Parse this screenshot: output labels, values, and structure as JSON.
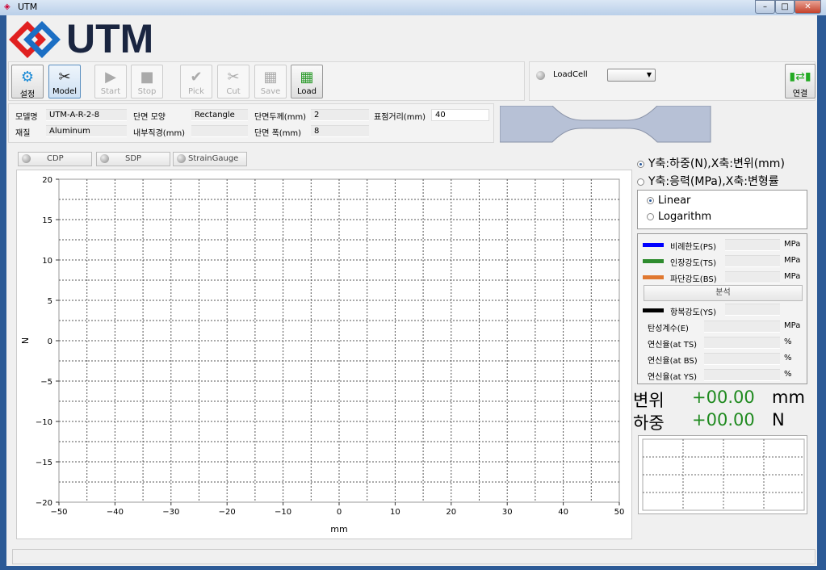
{
  "window": {
    "title": "UTM",
    "icon": "utm-logo-icon"
  },
  "logo": {
    "text": "UTM"
  },
  "toolbar": {
    "buttons": [
      {
        "label": "설정",
        "icon": "gear-icon",
        "enabled": true
      },
      {
        "label": "Model",
        "icon": "tools-icon",
        "enabled": true
      },
      {
        "label": "Start",
        "icon": "play-icon",
        "enabled": false
      },
      {
        "label": "Stop",
        "icon": "stop-icon",
        "enabled": false
      },
      {
        "label": "Pick",
        "icon": "check-icon",
        "enabled": false
      },
      {
        "label": "Cut",
        "icon": "scissors-icon",
        "enabled": false
      },
      {
        "label": "Save",
        "icon": "excel-icon",
        "enabled": false
      },
      {
        "label": "Load",
        "icon": "excel-icon",
        "enabled": true
      }
    ],
    "loadcell_label": "LoadCell",
    "loadcell_value": "",
    "connect_label": "연결"
  },
  "specimen": {
    "model_label": "모델명",
    "model_value": "UTM-A-R-2-8",
    "material_label": "재질",
    "material_value": "Aluminum",
    "shape_label": "단면 모양",
    "shape_value": "Rectangle",
    "inner_diameter_label": "내부직경(mm)",
    "inner_diameter_value": "",
    "thickness_label": "단면두께(mm)",
    "thickness_value": "2",
    "width_label": "단면 폭(mm)",
    "width_value": "8",
    "gauge_label": "표점거리(mm)",
    "gauge_value": "40"
  },
  "sensors": [
    "CDP",
    "SDP",
    "StrainGauge"
  ],
  "axis_mode": {
    "options": [
      "Y축:하중(N),X축:변위(mm)",
      "Y축:응력(MPa),X축:변형률"
    ],
    "selected": 0
  },
  "scale": {
    "options": [
      "Linear",
      "Logarithm"
    ],
    "selected": 0
  },
  "stats": {
    "rows": [
      {
        "label": "비례한도(PS)",
        "unit": "MPa",
        "color": "#0000ff"
      },
      {
        "label": "인장강도(TS)",
        "unit": "MPa",
        "color": "#2e8b2e"
      },
      {
        "label": "파단강도(BS)",
        "unit": "MPa",
        "color": "#e07830"
      }
    ],
    "analyze_label": "분석",
    "yield": {
      "label": "항복강도(YS)",
      "color": "#000000"
    },
    "rows2": [
      {
        "label": "탄성계수(E)",
        "unit": "MPa"
      },
      {
        "label": "연신율(at TS)",
        "unit": "%"
      },
      {
        "label": "연신율(at BS)",
        "unit": "%"
      },
      {
        "label": "연신율(at YS)",
        "unit": "%"
      }
    ]
  },
  "readout": {
    "disp_label": "변위",
    "disp_value": "+00.00",
    "disp_unit": "mm",
    "load_label": "하중",
    "load_value": "+00.00",
    "load_unit": "N"
  },
  "chart_data": {
    "type": "line",
    "series": [],
    "xlabel": "mm",
    "ylabel": "N",
    "xlim": [
      -50,
      50
    ],
    "ylim": [
      -20,
      20
    ],
    "xticks": [
      -50,
      -40,
      -30,
      -20,
      -10,
      0,
      10,
      20,
      30,
      40,
      50
    ],
    "yticks": [
      20,
      15,
      10,
      5,
      0,
      -5,
      -10,
      -15,
      -20
    ],
    "grid": true
  }
}
